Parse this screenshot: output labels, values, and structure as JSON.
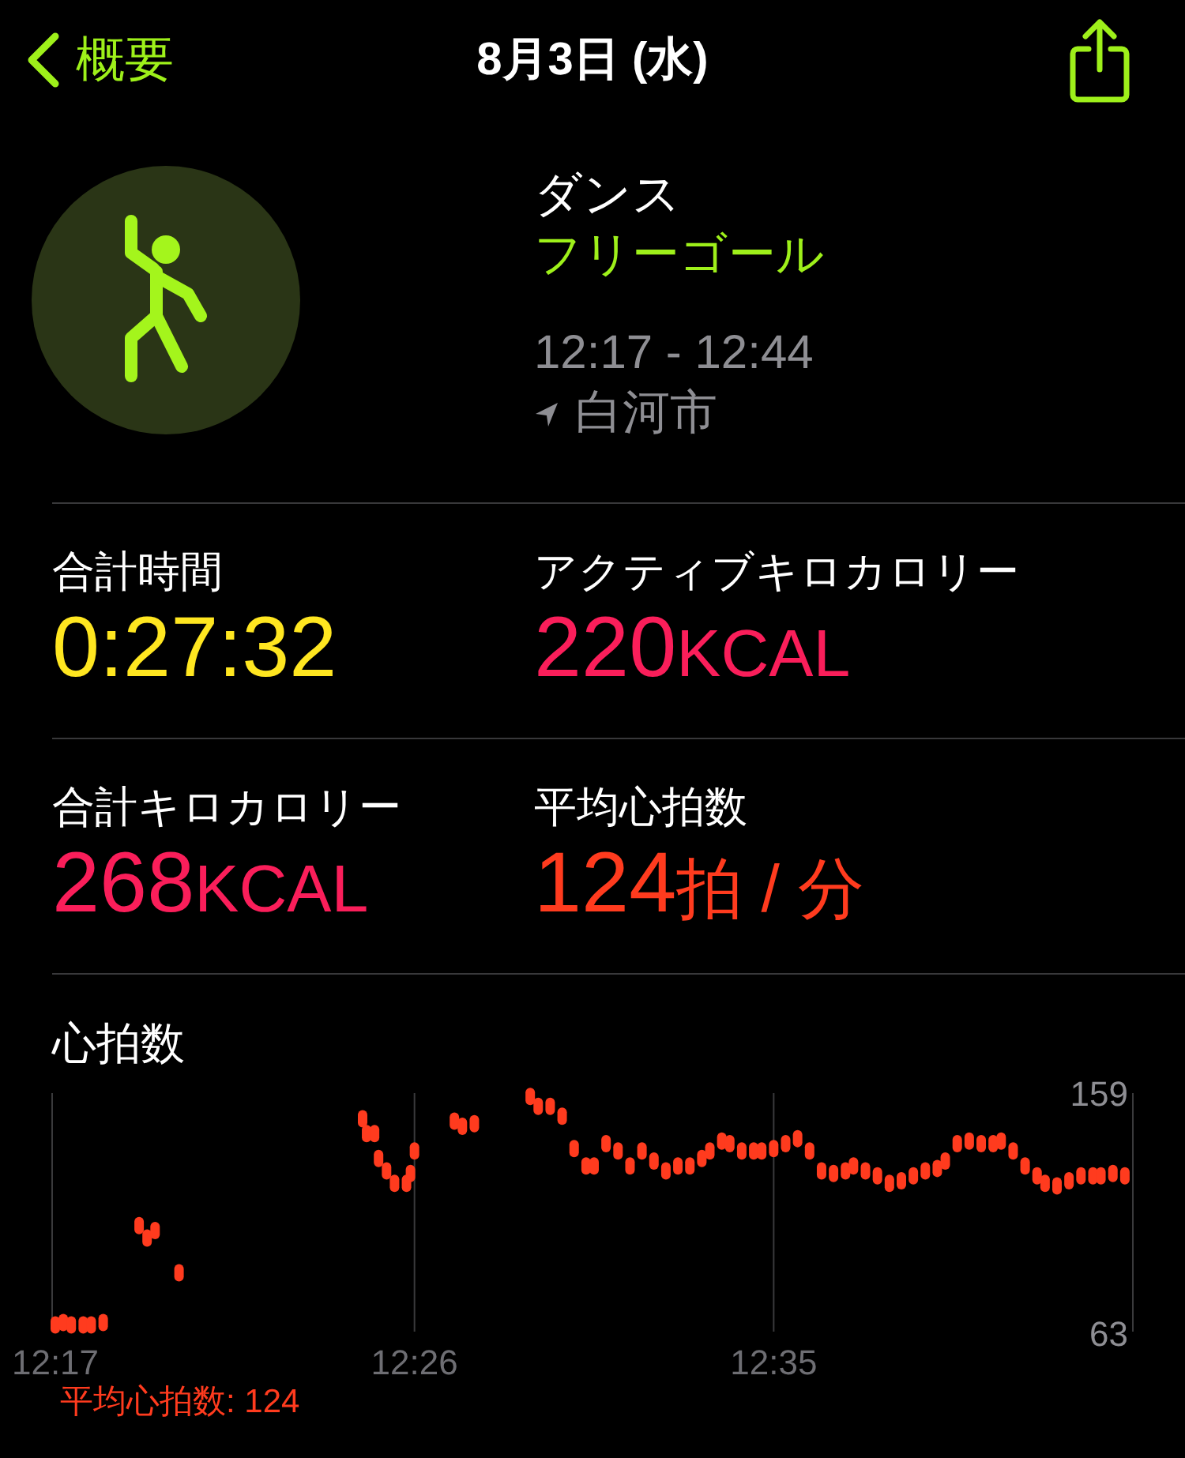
{
  "header": {
    "back_label": "概要",
    "title": "8月3日 (水)"
  },
  "workout": {
    "name": "ダンス",
    "goal": "フリーゴール",
    "time_range": "12:17 - 12:44",
    "location": "白河市"
  },
  "stats": [
    {
      "label": "合計時間",
      "value": "0:27:32",
      "color": "#ffe620"
    },
    {
      "label": "アクティブキロカロリー",
      "value": "220",
      "unit": "KCAL",
      "color": "#fa1e5a"
    },
    {
      "label": "合計キロカロリー",
      "value": "268",
      "unit": "KCAL",
      "color": "#fa1e5a"
    },
    {
      "label": "平均心拍数",
      "value": "124",
      "unit": "拍 / 分",
      "color": "#ff3b1e"
    }
  ],
  "heart_rate": {
    "average": "平均心拍数: 124",
    "chart_data": {
      "type": "scatter",
      "title": "心拍数",
      "xlim": [
        737,
        764
      ],
      "ylim": [
        63,
        159
      ],
      "xticks": [
        {
          "value": 737,
          "label": "12:17"
        },
        {
          "value": 746,
          "label": "12:26"
        },
        {
          "value": 755,
          "label": "12:35"
        }
      ],
      "yticks": [
        63,
        159
      ],
      "series": [
        {
          "color": "#ff3b1e",
          "x": [
            737.0,
            737.2,
            737.4,
            737.7,
            737.9,
            738.2,
            739.1,
            739.3,
            739.5,
            740.1,
            744.7,
            744.8,
            745.0,
            745.1,
            745.3,
            745.5,
            745.8,
            745.9,
            746.0,
            747.0,
            747.2,
            747.5,
            748.9,
            749.1,
            749.4,
            749.7,
            750.0,
            750.3,
            750.5,
            750.8,
            751.1,
            751.4,
            751.7,
            752.0,
            752.3,
            752.6,
            752.9,
            753.2,
            753.4,
            753.7,
            753.9,
            754.2,
            754.5,
            754.7,
            755.0,
            755.3,
            755.6,
            755.9,
            756.2,
            756.5,
            756.8,
            757.0,
            757.3,
            757.6,
            757.9,
            758.2,
            758.5,
            758.8,
            759.1,
            759.3,
            759.6,
            759.9,
            760.2,
            760.5,
            760.7,
            761.0,
            761.3,
            761.6,
            761.8,
            762.1,
            762.4,
            762.7,
            763.0,
            763.2,
            763.5,
            763.8
          ],
          "values": [
            66,
            67,
            66,
            66,
            66,
            67,
            106,
            101,
            104,
            87,
            149,
            143,
            143,
            133,
            128,
            123,
            123,
            127,
            136,
            148,
            146,
            147,
            158,
            154,
            154,
            150,
            137,
            130,
            130,
            139,
            136,
            130,
            136,
            132,
            128,
            130,
            130,
            133,
            136,
            140,
            139,
            136,
            136,
            136,
            137,
            139,
            141,
            136,
            128,
            127,
            128,
            130,
            128,
            126,
            123,
            124,
            126,
            128,
            129,
            132,
            139,
            140,
            139,
            139,
            140,
            136,
            130,
            126,
            123,
            122,
            124,
            126,
            126,
            126,
            127,
            126
          ]
        }
      ]
    }
  }
}
